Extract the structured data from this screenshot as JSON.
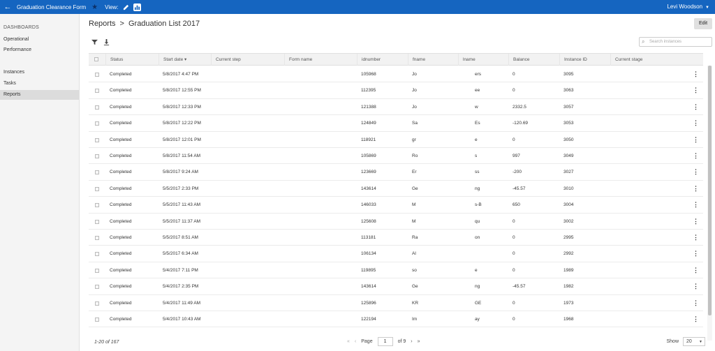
{
  "topbar": {
    "title": "Graduation Clearance Form",
    "view_label": "View:",
    "user": "Levi Woodson"
  },
  "sidebar": {
    "section_label": "DASHBOARDS",
    "items": [
      "Operational",
      "Performance",
      "Instances",
      "Tasks",
      "Reports"
    ],
    "active": "Reports"
  },
  "breadcrumb": {
    "parent": "Reports",
    "separator": ">",
    "current": "Graduation List 2017"
  },
  "edit_label": "Edit",
  "search": {
    "placeholder": "Search instances"
  },
  "columns": [
    "Status",
    "Start date ▾",
    "Current step",
    "Form name",
    "idnumber",
    "fname",
    "lname",
    "Balance",
    "Instance ID",
    "Current stage"
  ],
  "rows": [
    {
      "status": "Completed",
      "start": "5/8/2017 4:47 PM",
      "id": "105968",
      "fname": "Jo",
      "lname": "ers",
      "balance": "0",
      "instance": "3095"
    },
    {
      "status": "Completed",
      "start": "5/8/2017 12:55 PM",
      "id": "112395",
      "fname": "Jo",
      "lname": "ee",
      "balance": "0",
      "instance": "3063"
    },
    {
      "status": "Completed",
      "start": "5/8/2017 12:33 PM",
      "id": "121388",
      "fname": "Jo",
      "lname": "w",
      "balance": "2332.5",
      "instance": "3057"
    },
    {
      "status": "Completed",
      "start": "5/8/2017 12:22 PM",
      "id": "124849",
      "fname": "Sa",
      "lname": "Es",
      "balance": "-120.69",
      "instance": "3053"
    },
    {
      "status": "Completed",
      "start": "5/8/2017 12:01 PM",
      "id": "118921",
      "fname": "gr",
      "lname": "e",
      "balance": "0",
      "instance": "3050"
    },
    {
      "status": "Completed",
      "start": "5/8/2017 11:54 AM",
      "id": "105869",
      "fname": "Ro",
      "lname": "s",
      "balance": "997",
      "instance": "3049"
    },
    {
      "status": "Completed",
      "start": "5/8/2017 9:24 AM",
      "id": "123669",
      "fname": "Er",
      "lname": "ss",
      "balance": "-200",
      "instance": "3027"
    },
    {
      "status": "Completed",
      "start": "5/5/2017 2:33 PM",
      "id": "143614",
      "fname": "Ge",
      "lname": "ng",
      "balance": "-45.57",
      "instance": "3010"
    },
    {
      "status": "Completed",
      "start": "5/5/2017 11:43 AM",
      "id": "146033",
      "fname": "M",
      "lname": "s-B",
      "balance": "650",
      "instance": "3004"
    },
    {
      "status": "Completed",
      "start": "5/5/2017 11:37 AM",
      "id": "125608",
      "fname": "M",
      "lname": "qu",
      "balance": "0",
      "instance": "3002"
    },
    {
      "status": "Completed",
      "start": "5/5/2017 8:51 AM",
      "id": "113181",
      "fname": "Ra",
      "lname": "on",
      "balance": "0",
      "instance": "2995"
    },
    {
      "status": "Completed",
      "start": "5/5/2017 6:34 AM",
      "id": "106134",
      "fname": "Al",
      "lname": "",
      "balance": "0",
      "instance": "2992"
    },
    {
      "status": "Completed",
      "start": "5/4/2017 7:11 PM",
      "id": "119895",
      "fname": "so",
      "lname": "e",
      "balance": "0",
      "instance": "1989"
    },
    {
      "status": "Completed",
      "start": "5/4/2017 2:35 PM",
      "id": "143614",
      "fname": "Ge",
      "lname": "ng",
      "balance": "-45.57",
      "instance": "1982"
    },
    {
      "status": "Completed",
      "start": "5/4/2017 11:49 AM",
      "id": "125896",
      "fname": "KR",
      "lname": "GE",
      "balance": "0",
      "instance": "1973"
    },
    {
      "status": "Completed",
      "start": "5/4/2017 10:43 AM",
      "id": "122194",
      "fname": "Im",
      "lname": "ay",
      "balance": "0",
      "instance": "1968"
    }
  ],
  "footer": {
    "count": "1-20 of 167",
    "page_label": "Page",
    "page": "1",
    "of_pages": "of 9",
    "show_label": "Show",
    "show_value": "20"
  }
}
